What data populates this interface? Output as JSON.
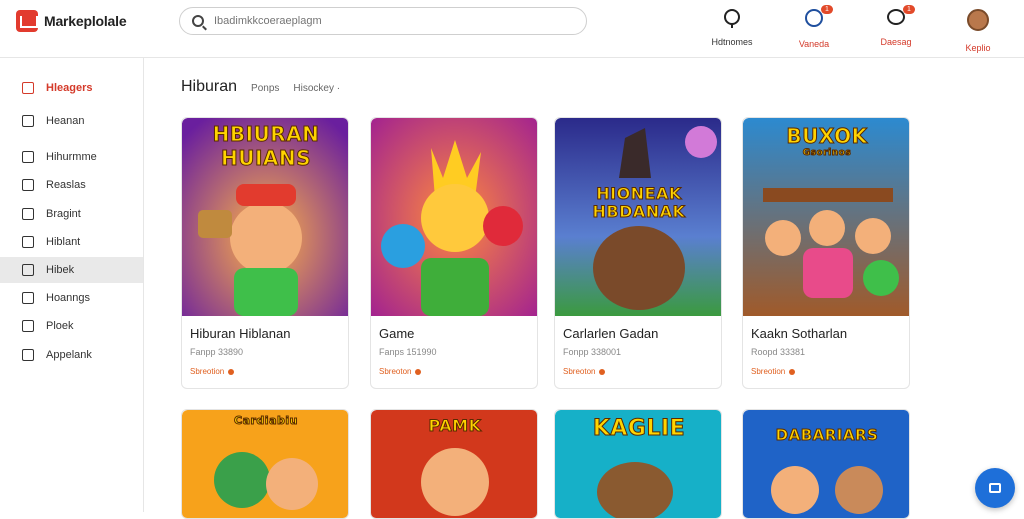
{
  "header": {
    "brand": "Markeplolale",
    "search_placeholder": "Ibadimkkcoeraeplagm",
    "actions": [
      {
        "label": "Hdtnomes",
        "icon": "notification-icon",
        "badge": ""
      },
      {
        "label": "Vaneda",
        "icon": "globe-icon",
        "badge": "1"
      },
      {
        "label": "Daesag",
        "icon": "chat-icon",
        "badge": "1"
      },
      {
        "label": "Keplio",
        "icon": "avatar-icon",
        "badge": ""
      }
    ]
  },
  "sidebar": {
    "items": [
      {
        "label": "Hleagers",
        "icon": "home-icon"
      },
      {
        "label": "Heanan",
        "icon": "grid-icon"
      },
      {
        "label": "Hihurmme",
        "icon": "list-icon"
      },
      {
        "label": "Reaslas",
        "icon": "box-icon"
      },
      {
        "label": "Bragint",
        "icon": "tag-icon"
      },
      {
        "label": "Hiblant",
        "icon": "document-icon"
      },
      {
        "label": "Hibek",
        "icon": "book-icon"
      },
      {
        "label": "Hoanngs",
        "icon": "settings-icon"
      },
      {
        "label": "Ploek",
        "icon": "flag-icon"
      },
      {
        "label": "Appelank",
        "icon": "app-icon"
      }
    ]
  },
  "main": {
    "title": "Hiburan",
    "tabs": [
      "Ponps",
      "Hisockey ·"
    ]
  },
  "cards": [
    {
      "art_title_1": "HBIURAN",
      "art_title_2": "HUIANS",
      "title": "Hiburan Hiblanan",
      "meta": "Fanpp 33890",
      "tag": "Sbreotion",
      "palette": [
        "#7a2ea8",
        "#ff9f1c"
      ]
    },
    {
      "art_title_1": "",
      "art_title_2": "",
      "title": "Game",
      "meta": "Fanps 151990",
      "tag": "Sbreoton",
      "palette": [
        "#b22ca0",
        "#ff7a1a"
      ]
    },
    {
      "art_title_1": "HIONEAK",
      "art_title_2": "HBDANAK",
      "title": "Carlarlen Gadan",
      "meta": "Fonpp 338001",
      "tag": "Sbreoton",
      "palette": [
        "#3b2a8a",
        "#2e8f3a"
      ]
    },
    {
      "art_title_1": "BUXOK",
      "art_title_2": "Gsorinos",
      "title": "Kaakn Sotharlan",
      "meta": "Roopd 33381",
      "tag": "Sbreotion",
      "palette": [
        "#2c8ad0",
        "#e84b8a"
      ]
    },
    {
      "art_title_1": "Cardiabiu",
      "art_title_2": "",
      "title": "",
      "meta": "",
      "tag": "",
      "palette": [
        "#f7a21b",
        "#3aa04a"
      ]
    },
    {
      "art_title_1": "PAMK",
      "art_title_2": "",
      "title": "",
      "meta": "",
      "tag": "",
      "palette": [
        "#d2381c",
        "#ffb21c"
      ]
    },
    {
      "art_title_1": "KAGLIE",
      "art_title_2": "",
      "title": "",
      "meta": "",
      "tag": "",
      "palette": [
        "#16b0c8",
        "#2e8f3a"
      ]
    },
    {
      "art_title_1": "DABARIARS",
      "art_title_2": "",
      "title": "",
      "meta": "",
      "tag": "",
      "palette": [
        "#1f63c7",
        "#f2a51a"
      ]
    }
  ],
  "colors": {
    "accent": "#d43a2a",
    "fab": "#1e6fd9"
  }
}
